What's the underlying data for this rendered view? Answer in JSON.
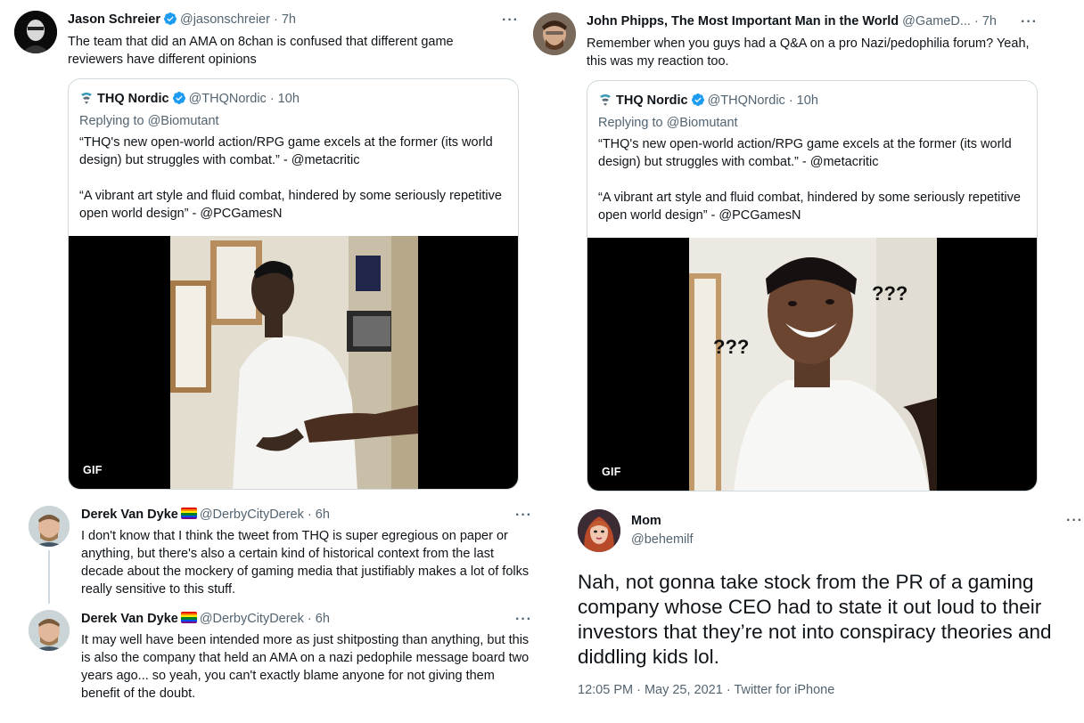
{
  "tweet1": {
    "name": "Jason Schreier",
    "handle": "@jasonschreier",
    "time": "· 7h",
    "more": "···",
    "text": "The team that did an AMA on 8chan is confused that different game reviewers have different opinions",
    "quote": {
      "name": "THQ Nordic",
      "handle": "@THQNordic",
      "time": "· 10h",
      "reply": "Replying to @Biomutant",
      "line1": "“THQ's new open-world action/RPG game excels at the former (its world design) but struggles with combat.” - @metacritic",
      "line2": "“A vibrant art style and fluid combat, hindered by some seriously repetitive open world design” - @PCGamesN",
      "gif_label": "GIF"
    }
  },
  "tweet2": {
    "name": "John Phipps, The Most Important Man in the World",
    "handle": "@GameD...",
    "time": "· 7h",
    "more": "···",
    "text": "Remember when you guys had a Q&A on a pro Nazi/pedophilia forum? Yeah, this was my reaction too.",
    "quote": {
      "name": "THQ Nordic",
      "handle": "@THQNordic",
      "time": "· 10h",
      "reply": "Replying to @Biomutant",
      "line1": "“THQ's new open-world action/RPG game excels at the former (its world design) but struggles with combat.” - @metacritic",
      "line2": "“A vibrant art style and fluid combat, hindered by some seriously repetitive open world design” - @PCGamesN",
      "gif_label": "GIF",
      "marks_left": "???",
      "marks_right": "???"
    }
  },
  "tweet3": {
    "name": "Derek Van Dyke",
    "handle": "@DerbyCityDerek",
    "time": "· 6h",
    "more": "···",
    "text": "I don't know that I think the tweet from THQ is super egregious on paper or anything, but there's also a certain kind of historical context from the last decade about the mockery of gaming media that justifiably makes a lot of folks really sensitive to this stuff."
  },
  "tweet4": {
    "name": "Derek Van Dyke",
    "handle": "@DerbyCityDerek",
    "time": "· 6h",
    "more": "···",
    "text": "It may well have been intended more as just shitposting than anything, but this is also the company that held an AMA on a nazi pedophile message board two years ago... so yeah, you can't exactly blame anyone for not giving them benefit of the doubt."
  },
  "tweet5": {
    "name": "Mom",
    "handle": "@behemilf",
    "more": "···",
    "text": "Nah, not gonna take stock from the PR of a gaming company whose CEO had to state it out loud to their investors that they’re not into conspiracy theories and diddling kids lol.",
    "meta": "12:05 PM · May 25, 2021 · Twitter for iPhone"
  },
  "colors": {
    "verified": "#1d9bf0",
    "secondary_text": "#536471",
    "border": "#cfd9de"
  }
}
